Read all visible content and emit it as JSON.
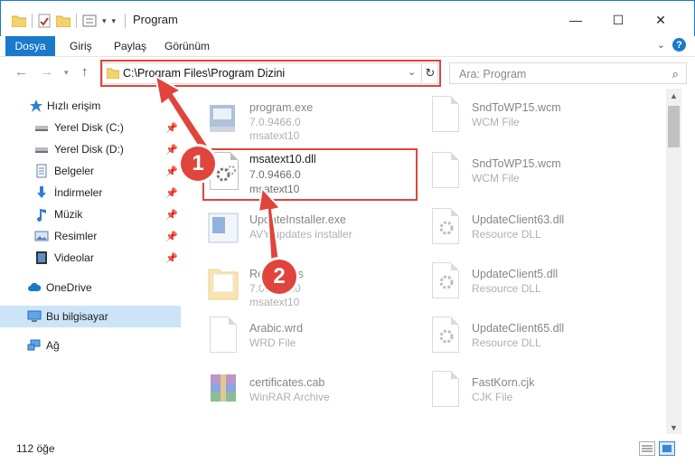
{
  "window": {
    "title": "Program",
    "minimize_glyph": "—",
    "maximize_glyph": "☐",
    "close_glyph": "✕"
  },
  "ribbon": {
    "file_tab": "Dosya",
    "tabs": [
      "Giriş",
      "Paylaş",
      "Görünüm"
    ]
  },
  "address": {
    "path": "C:\\Program Files\\Program Dizini",
    "search_placeholder": "Ara: Program"
  },
  "sidebar": {
    "items": [
      {
        "label": "Hızlı erişim",
        "icon": "star-icon",
        "pinned": false
      },
      {
        "label": "Yerel Disk (C:)",
        "icon": "drive-icon",
        "pinned": true
      },
      {
        "label": "Yerel Disk (D:)",
        "icon": "drive-icon",
        "pinned": true
      },
      {
        "label": "Belgeler",
        "icon": "documents-icon",
        "pinned": true
      },
      {
        "label": "İndirmeler",
        "icon": "download-icon",
        "pinned": true
      },
      {
        "label": "Müzik",
        "icon": "music-icon",
        "pinned": true
      },
      {
        "label": "Resimler",
        "icon": "pictures-icon",
        "pinned": true
      },
      {
        "label": "Videolar",
        "icon": "videos-icon",
        "pinned": true
      },
      {
        "label": "OneDrive",
        "icon": "cloud-icon",
        "pinned": false
      },
      {
        "label": "Bu bilgisayar",
        "icon": "computer-icon",
        "pinned": false,
        "selected": true
      },
      {
        "label": "Ağ",
        "icon": "network-icon",
        "pinned": false
      }
    ]
  },
  "files_left": [
    {
      "name": "program.exe",
      "line1": "7.0.9466.0",
      "line2": "msatext10",
      "icon": "exe-icon",
      "faded": true
    },
    {
      "name": "msatext10.dll",
      "line1": "7.0.9466.0",
      "line2": "msatext10",
      "icon": "dll-icon",
      "faded": false
    },
    {
      "name": "UpdateInstaller.exe",
      "line1": "AVY updates installer",
      "line2": "",
      "icon": "installer-icon",
      "faded": true
    },
    {
      "name": "Resources",
      "line1": "7.0.9466.0",
      "line2": "msatext10",
      "icon": "folder-icon",
      "faded": true
    },
    {
      "name": "Arabic.wrd",
      "line1": "WRD File",
      "line2": "",
      "icon": "file-icon",
      "faded": true
    },
    {
      "name": "certificates.cab",
      "line1": "WinRAR Archive",
      "line2": "",
      "icon": "winrar-icon",
      "faded": true
    }
  ],
  "files_right": [
    {
      "name": "SndToWP15.wcm",
      "line1": "WCM File",
      "icon": "file-icon"
    },
    {
      "name": "SndToWP15.wcm",
      "line1": "WCM File",
      "icon": "file-icon"
    },
    {
      "name": "UpdateClient63.dll",
      "line1": "Resource DLL",
      "icon": "dll-icon"
    },
    {
      "name": "UpdateClient5.dll",
      "line1": "Resource DLL",
      "icon": "dll-icon"
    },
    {
      "name": "UpdateClient65.dll",
      "line1": "Resource DLL",
      "icon": "dll-icon"
    },
    {
      "name": "FastKorn.cjk",
      "line1": "CJK File",
      "icon": "file-icon"
    }
  ],
  "status": {
    "count": "112 öğe"
  },
  "annotations": {
    "step1": "1",
    "step2": "2",
    "color": "#e0443c"
  }
}
